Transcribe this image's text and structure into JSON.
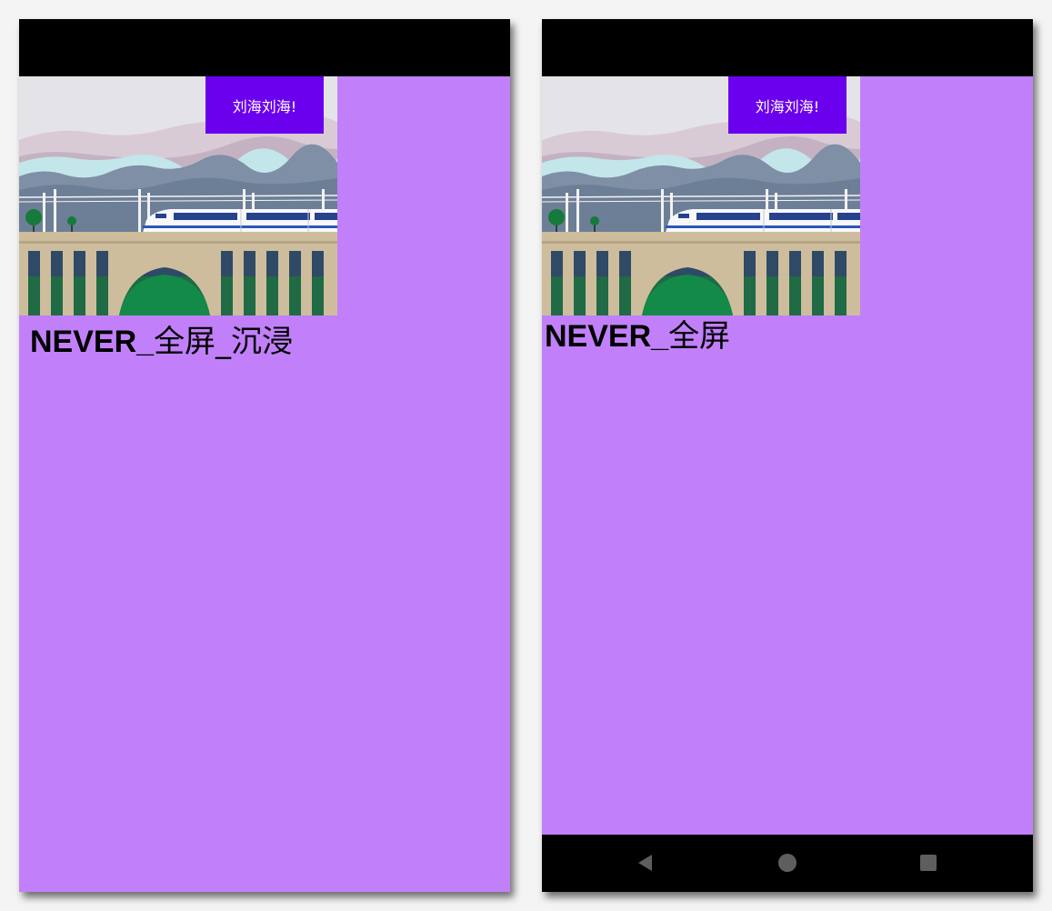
{
  "left_screen": {
    "notch_button_label": "刘海刘海!",
    "mode_title_prefix": "NEVER_",
    "mode_title_suffix": "全屏_沉浸"
  },
  "right_screen": {
    "notch_button_label": "刘海刘海!",
    "mode_title_prefix": "NEVER_",
    "mode_title_suffix": "全屏",
    "nav_bar": {
      "back_icon": "back-triangle-icon",
      "home_icon": "home-circle-icon",
      "recents_icon": "recents-square-icon"
    }
  },
  "colors": {
    "screen_background": "#c180fa",
    "button_background": "#6a00ee",
    "system_bars": "#000000",
    "nav_icon": "#5e5e5e"
  }
}
